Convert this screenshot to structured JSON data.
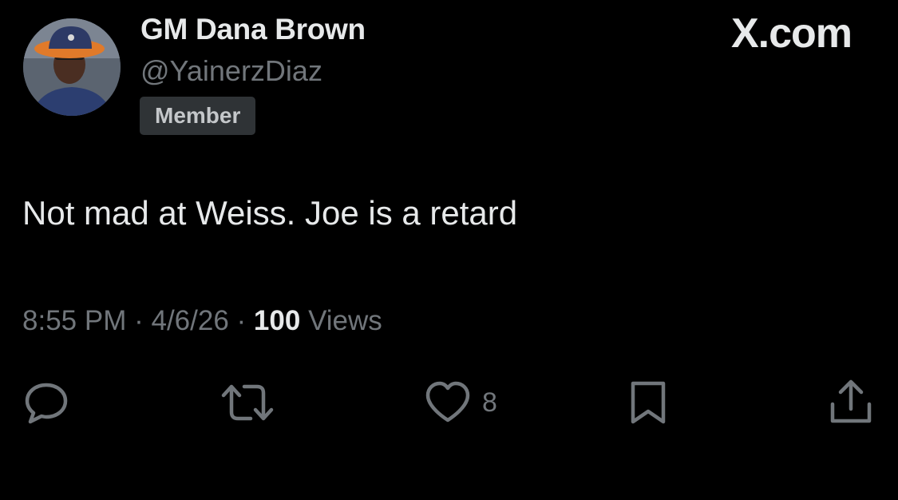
{
  "post": {
    "author": {
      "display_name": "GM Dana Brown",
      "handle": "@YainerzDiaz",
      "badge": "Member"
    },
    "brand": "X.com",
    "text": "Not mad at Weiss. Joe is a retard",
    "time": "8:55 PM",
    "date": "4/6/26",
    "separator": "·",
    "views_count": "100",
    "views_label": "Views"
  },
  "actions": {
    "reply_icon": "reply-icon",
    "repost_icon": "repost-icon",
    "like_icon": "heart-icon",
    "like_count": "8",
    "bookmark_icon": "bookmark-icon",
    "share_icon": "share-icon"
  },
  "colors": {
    "background": "#000000",
    "primary_text": "#e7e9ea",
    "secondary_text": "#71767b",
    "badge_bg": "#2f3336"
  }
}
